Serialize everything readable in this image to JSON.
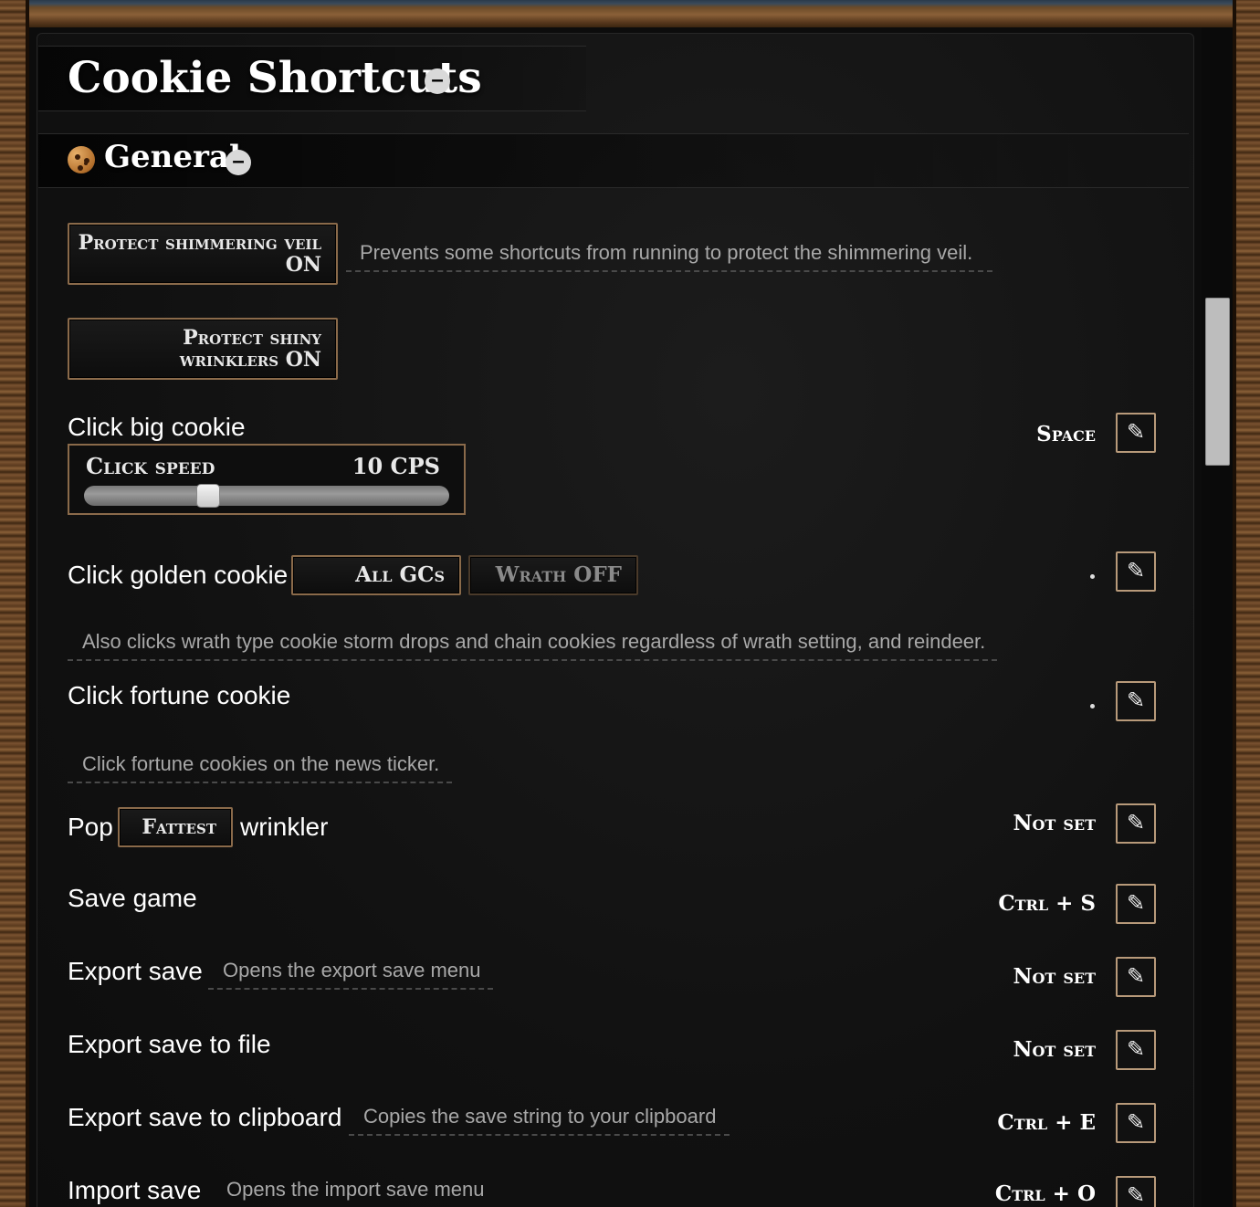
{
  "panel": {
    "title": "Cookie Shortcuts",
    "section": "General"
  },
  "toggles": {
    "protect_veil": "Protect shimmering veil ON",
    "protect_veil_desc": "Prevents some shortcuts from running to protect the shimmering veil.",
    "protect_wrinklers": "Protect shiny wrinklers ON"
  },
  "click_big_cookie": {
    "label": "Click big cookie",
    "slider_label": "Click speed",
    "slider_value": "10 CPS",
    "slider_fraction": 0.33,
    "key": "Space"
  },
  "click_golden_cookie": {
    "label": "Click golden cookie",
    "mode_button": "All GCs",
    "wrath_button": "Wrath OFF",
    "desc": "Also clicks wrath type cookie storm drops and chain cookies regardless of wrath setting, and reindeer."
  },
  "click_fortune_cookie": {
    "label": "Click fortune cookie",
    "desc": "Click fortune cookies on the news ticker."
  },
  "pop_wrinkler": {
    "prefix": "Pop",
    "mode_button": "Fattest",
    "suffix": "wrinkler",
    "key": "Not set"
  },
  "save_game": {
    "label": "Save game",
    "key": "Ctrl + S"
  },
  "export_save": {
    "label": "Export save",
    "desc": "Opens the export save menu",
    "key": "Not set"
  },
  "export_file": {
    "label": "Export save to file",
    "key": "Not set"
  },
  "export_clipboard": {
    "label": "Export save to clipboard",
    "desc": "Copies the save string to your clipboard",
    "key": "Ctrl + E"
  },
  "import_save": {
    "label": "Import save",
    "desc": "Opens the import save menu",
    "key": "Ctrl + O"
  },
  "icons": {
    "edit": "pencil-icon",
    "collapse": "minus-icon",
    "section": "cookie-icon"
  },
  "colors": {
    "button_border": "#8a6a4a",
    "edit_border": "#b89a7a",
    "desc_text": "#a8a8a8"
  }
}
